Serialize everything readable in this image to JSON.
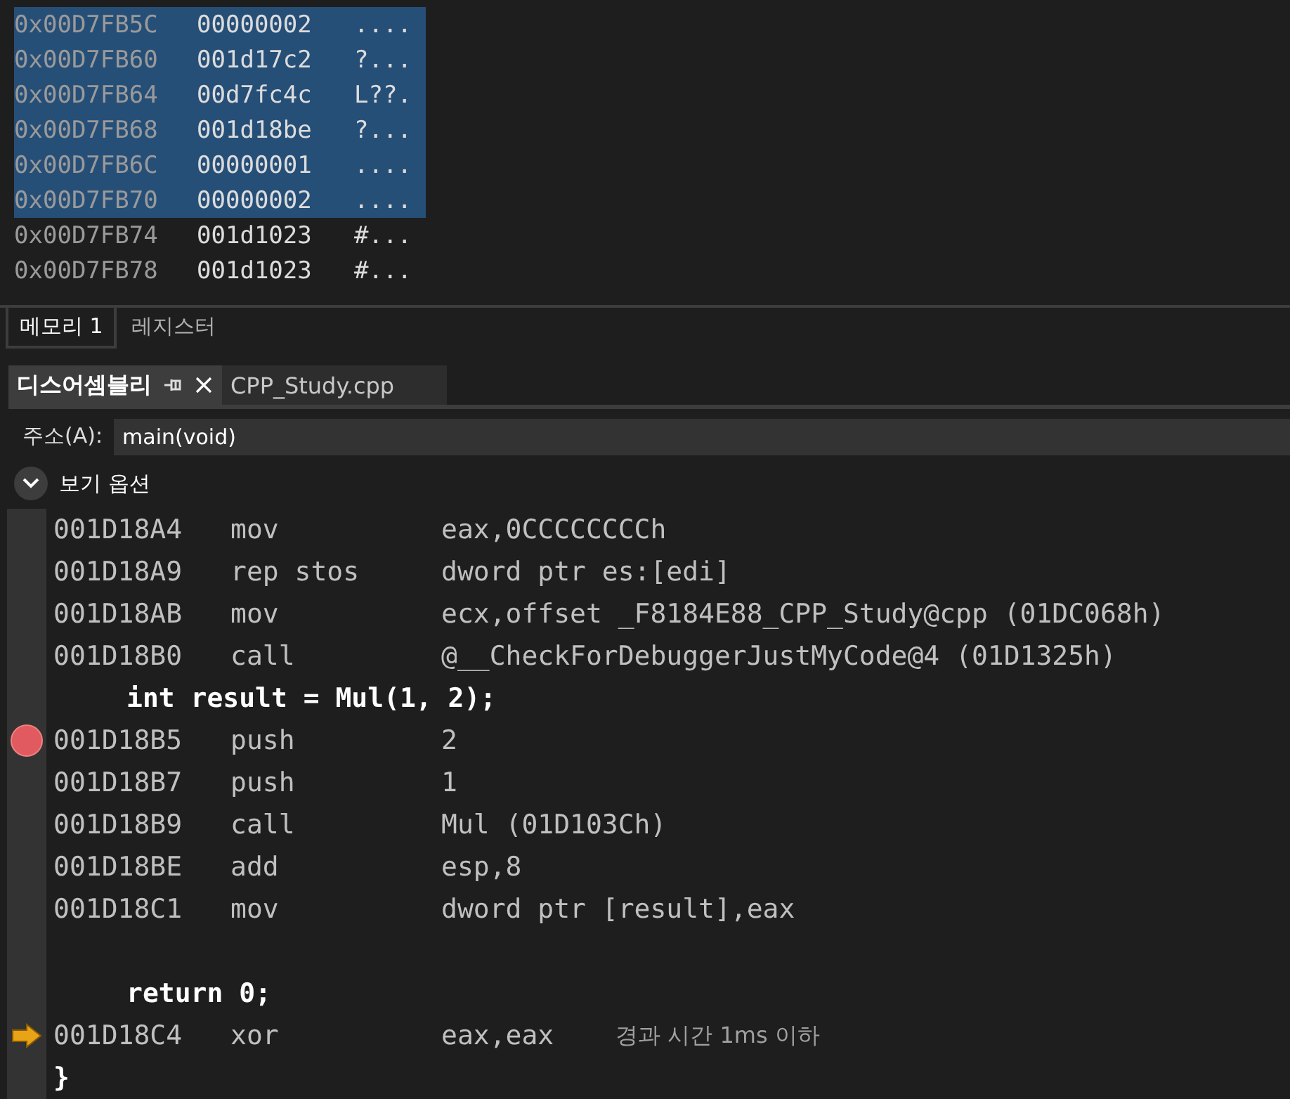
{
  "memory": {
    "rows": [
      {
        "address": "0x00D7FB5C",
        "value": "00000002",
        "ascii": "....",
        "selected": true
      },
      {
        "address": "0x00D7FB60",
        "value": "001d17c2",
        "ascii": "?...",
        "selected": true
      },
      {
        "address": "0x00D7FB64",
        "value": "00d7fc4c",
        "ascii": "L??.",
        "selected": true
      },
      {
        "address": "0x00D7FB68",
        "value": "001d18be",
        "ascii": "?...",
        "selected": true
      },
      {
        "address": "0x00D7FB6C",
        "value": "00000001",
        "ascii": "....",
        "selected": true
      },
      {
        "address": "0x00D7FB70",
        "value": "00000002",
        "ascii": "....",
        "selected": true
      },
      {
        "address": "0x00D7FB74",
        "value": "001d1023",
        "ascii": "#...",
        "selected": false
      },
      {
        "address": "0x00D7FB78",
        "value": "001d1023",
        "ascii": "#...",
        "selected": false
      }
    ]
  },
  "bottom_tabs": [
    {
      "label": "메모리 1",
      "selected": true
    },
    {
      "label": "레지스터",
      "selected": false
    }
  ],
  "document_tabs": [
    {
      "label": "디스어셈블리",
      "selected": true,
      "pinned": true
    },
    {
      "label": "CPP_Study.cpp",
      "selected": false,
      "pinned": false
    }
  ],
  "address_bar": {
    "label": "주소(A):",
    "value": "main(void)"
  },
  "view_options": {
    "label": "보기 옵션",
    "expanded": false
  },
  "lines": [
    {
      "kind": "asm",
      "address": "001D18A4",
      "mnemonic": "mov",
      "operands": "eax,0CCCCCCCCh",
      "breakpoint": false,
      "current": false
    },
    {
      "kind": "asm",
      "address": "001D18A9",
      "mnemonic": "rep stos",
      "operands": "dword ptr es:[edi]",
      "breakpoint": false,
      "current": false
    },
    {
      "kind": "asm",
      "address": "001D18AB",
      "mnemonic": "mov",
      "operands": "ecx,offset _F8184E88_CPP_Study@cpp (01DC068h)",
      "breakpoint": false,
      "current": false
    },
    {
      "kind": "asm",
      "address": "001D18B0",
      "mnemonic": "call",
      "operands": "@__CheckForDebuggerJustMyCode@4 (01D1325h)",
      "breakpoint": false,
      "current": false
    },
    {
      "kind": "source",
      "text": "int result = Mul(1, 2);",
      "indented": true
    },
    {
      "kind": "asm",
      "address": "001D18B5",
      "mnemonic": "push",
      "operands": "2",
      "breakpoint": true,
      "current": false
    },
    {
      "kind": "asm",
      "address": "001D18B7",
      "mnemonic": "push",
      "operands": "1",
      "breakpoint": false,
      "current": false
    },
    {
      "kind": "asm",
      "address": "001D18B9",
      "mnemonic": "call",
      "operands": "Mul (01D103Ch)",
      "breakpoint": false,
      "current": false
    },
    {
      "kind": "asm",
      "address": "001D18BE",
      "mnemonic": "add",
      "operands": "esp,8",
      "breakpoint": false,
      "current": false
    },
    {
      "kind": "asm",
      "address": "001D18C1",
      "mnemonic": "mov",
      "operands": "dword ptr [result],eax",
      "breakpoint": false,
      "current": false
    },
    {
      "kind": "blank"
    },
    {
      "kind": "source",
      "text": "return 0;",
      "indented": true
    },
    {
      "kind": "asm",
      "address": "001D18C4",
      "mnemonic": "xor",
      "operands": "eax,eax",
      "breakpoint": false,
      "current": true,
      "note": "경과 시간 1ms 이하"
    },
    {
      "kind": "source",
      "text": "}",
      "indented": false
    }
  ]
}
